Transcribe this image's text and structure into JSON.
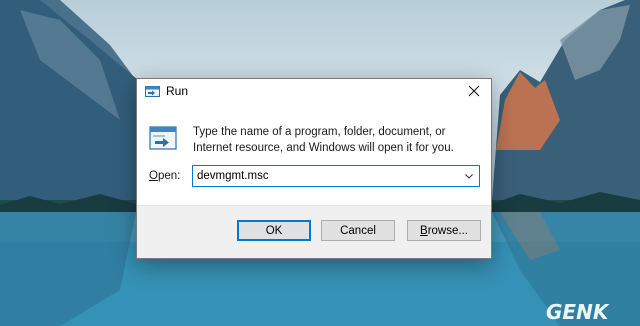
{
  "dialog": {
    "title": "Run",
    "description": "Type the name of a program, folder, document, or Internet resource, and Windows will open it for you.",
    "open_label_accel": "O",
    "open_label_rest": "pen:",
    "open_value": "devmgmt.msc",
    "buttons": {
      "ok": "OK",
      "cancel": "Cancel",
      "browse_accel": "B",
      "browse_rest": "rowse..."
    }
  },
  "watermark": "GENK",
  "colors": {
    "focus_accent": "#0078d7",
    "button_bar_bg": "#f0f0f0",
    "button_bg": "#e1e1e1"
  },
  "icons": [
    "run-icon",
    "close-icon",
    "chevron-down-icon"
  ]
}
